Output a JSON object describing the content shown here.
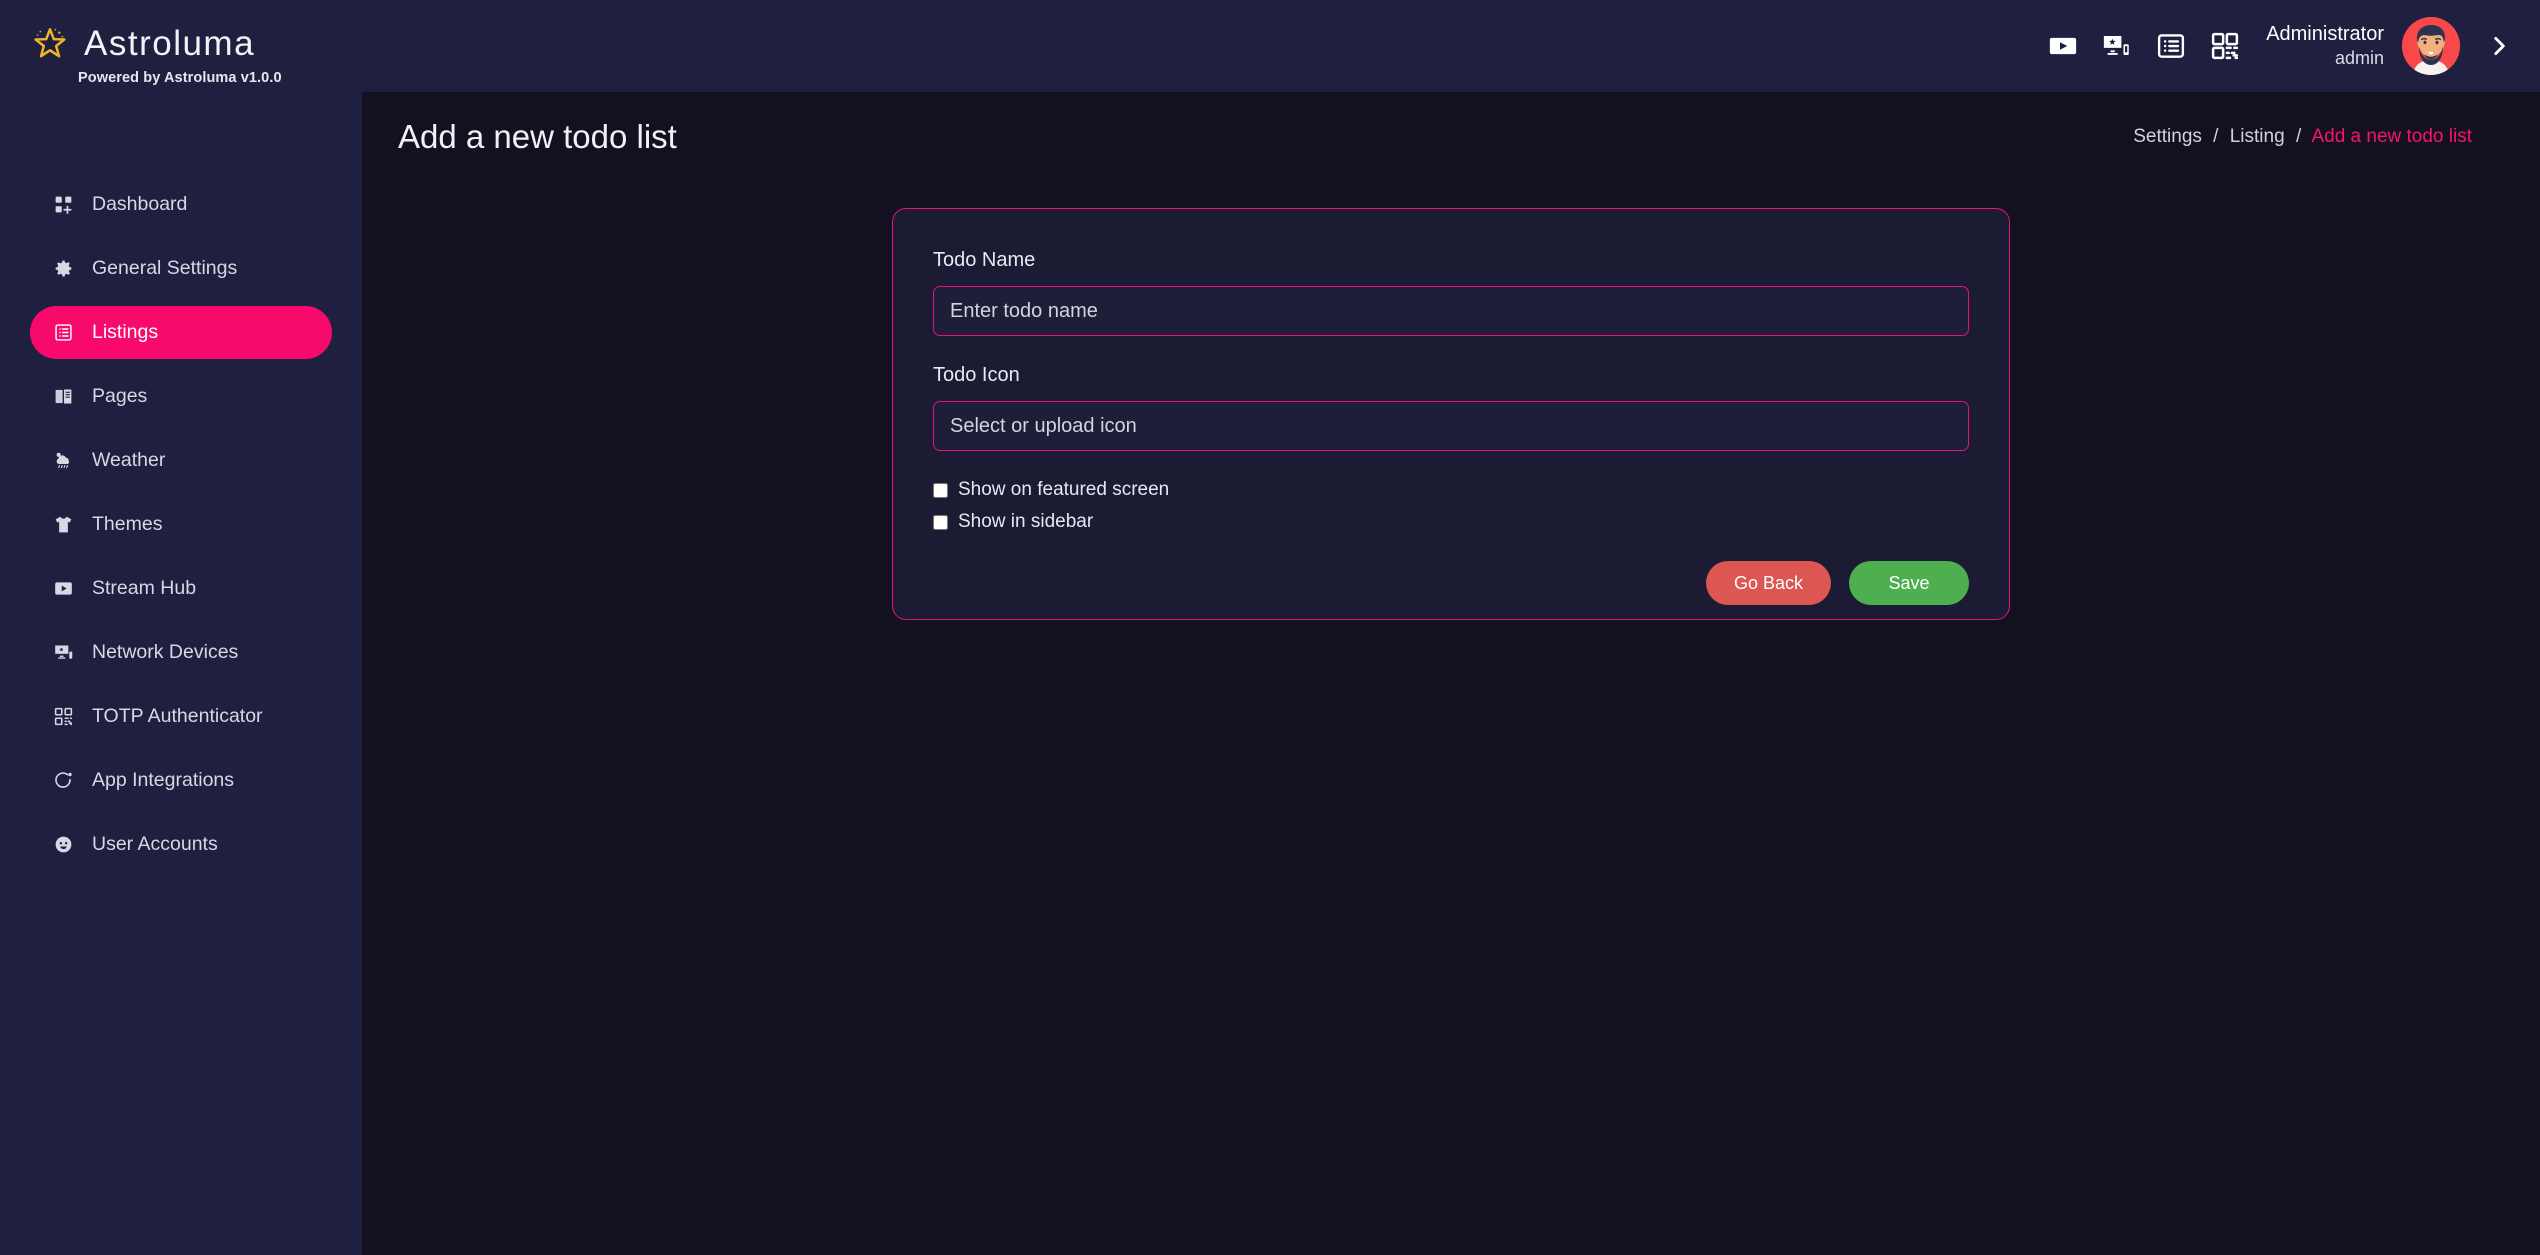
{
  "brand": {
    "title": "Astroluma",
    "subtitle": "Powered by Astroluma v1.0.0",
    "logo_icon": "star-icon",
    "logo_color": "#f0b429"
  },
  "sidebar": {
    "items": [
      {
        "label": "Dashboard",
        "icon": "grid-plus-icon",
        "active": false
      },
      {
        "label": "General Settings",
        "icon": "gear-icon",
        "active": false
      },
      {
        "label": "Listings",
        "icon": "list-box-icon",
        "active": true
      },
      {
        "label": "Pages",
        "icon": "book-icon",
        "active": false
      },
      {
        "label": "Weather",
        "icon": "cloud-rain-icon",
        "active": false
      },
      {
        "label": "Themes",
        "icon": "tshirt-icon",
        "active": false
      },
      {
        "label": "Stream Hub",
        "icon": "play-box-icon",
        "active": false
      },
      {
        "label": "Network Devices",
        "icon": "monitor-phone-icon",
        "active": false
      },
      {
        "label": "TOTP Authenticator",
        "icon": "qr-code-icon",
        "active": false
      },
      {
        "label": "App Integrations",
        "icon": "circle-dot-icon",
        "active": false
      },
      {
        "label": "User Accounts",
        "icon": "user-circle-icon",
        "active": false
      }
    ],
    "active_color": "#f80a6c",
    "background": "#1f2040"
  },
  "topbar": {
    "icons": [
      {
        "name": "play-box-icon"
      },
      {
        "name": "device-star-icon"
      },
      {
        "name": "list-box-icon"
      },
      {
        "name": "qr-code-icon"
      }
    ],
    "user_name": "Administrator",
    "user_role": "admin",
    "avatar_icon": "user-avatar",
    "expand_icon": "chevron-right-icon"
  },
  "page": {
    "title": "Add a new todo list",
    "breadcrumb": {
      "items": [
        "Settings",
        "Listing"
      ],
      "current": "Add a new todo list",
      "separator": "/",
      "current_color": "#f5146f"
    }
  },
  "form": {
    "name_label": "Todo Name",
    "name_value": "",
    "name_placeholder": "Enter todo name",
    "icon_label": "Todo Icon",
    "icon_value": "",
    "icon_placeholder": "Select or upload icon",
    "checkbox_featured": "Show on featured screen",
    "checkbox_featured_checked": false,
    "checkbox_sidebar": "Show in sidebar",
    "checkbox_sidebar_checked": false,
    "go_back_label": "Go Back",
    "save_label": "Save",
    "go_back_color": "#dc5751",
    "save_color": "#4eaf50",
    "border_color": "#e8127d"
  }
}
